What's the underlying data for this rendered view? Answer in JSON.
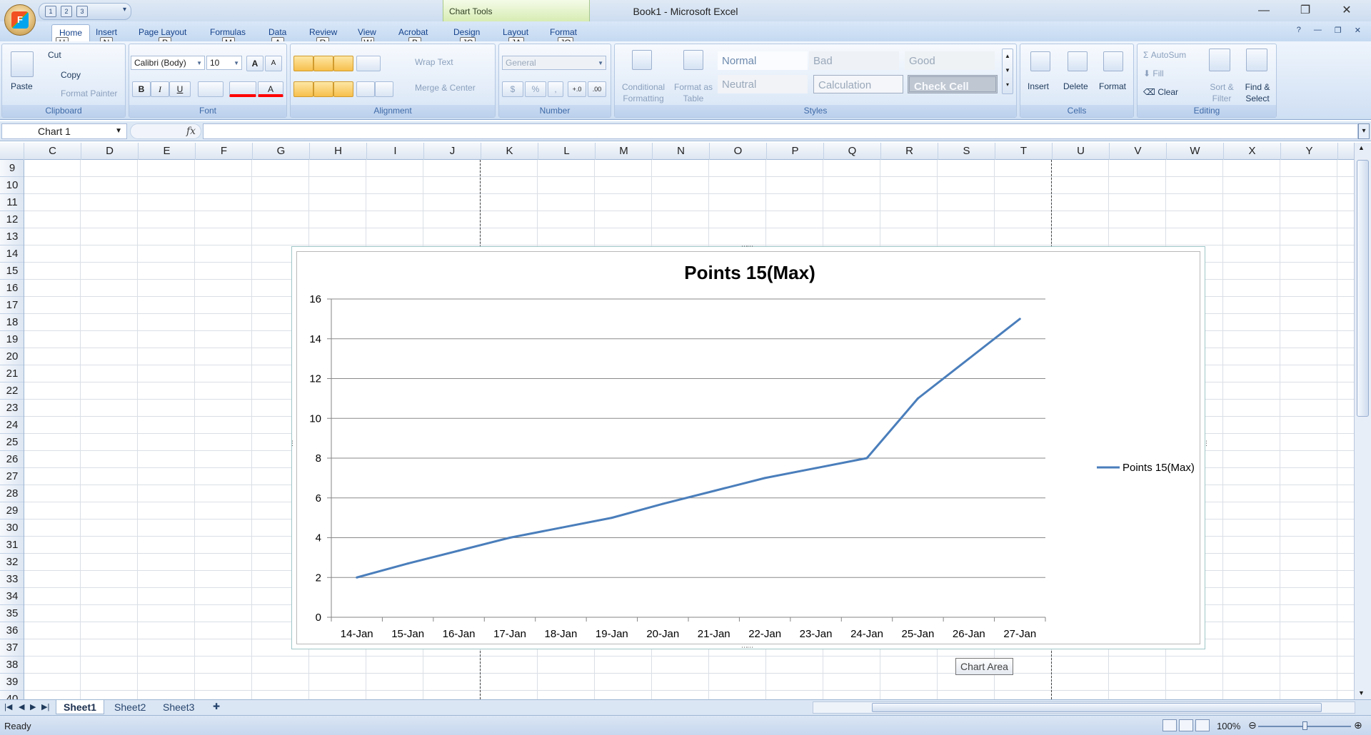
{
  "window": {
    "title": "Book1 - Microsoft Excel",
    "context_tab": "Chart Tools",
    "minimize": "—",
    "restore": "❐",
    "close": "✕"
  },
  "qat": {
    "keytips": [
      "1",
      "2",
      "3"
    ],
    "more": "▾"
  },
  "ribbon_tabs": [
    {
      "label": "Home",
      "keytip": "H"
    },
    {
      "label": "Insert",
      "keytip": "N"
    },
    {
      "label": "Page Layout",
      "keytip": "P"
    },
    {
      "label": "Formulas",
      "keytip": "M"
    },
    {
      "label": "Data",
      "keytip": "A"
    },
    {
      "label": "Review",
      "keytip": "R"
    },
    {
      "label": "View",
      "keytip": "W"
    },
    {
      "label": "Acrobat",
      "keytip": "B"
    },
    {
      "label": "Design",
      "keytip": "JC"
    },
    {
      "label": "Layout",
      "keytip": "JA"
    },
    {
      "label": "Format",
      "keytip": "JO"
    }
  ],
  "ribbon_right": {
    "help": "?",
    "minimize": "—",
    "restore": "❐",
    "close": "✕"
  },
  "clipboard": {
    "label": "Clipboard",
    "paste": "Paste",
    "cut": "Cut",
    "copy": "Copy",
    "format_painter": "Format Painter"
  },
  "font": {
    "label": "Font",
    "name": "Calibri (Body)",
    "size": "10",
    "grow": "A",
    "shrink": "A",
    "bold": "B",
    "italic": "I",
    "underline": "U",
    "font_color": "A"
  },
  "alignment": {
    "label": "Alignment",
    "wrap_text": "Wrap Text",
    "merge_center": "Merge & Center"
  },
  "number": {
    "label": "Number",
    "format": "General",
    "currency": "$",
    "percent": "%",
    "comma": ",",
    "inc_decimal": "+.0",
    "dec_decimal": ".00"
  },
  "styles": {
    "label": "Styles",
    "conditional_formatting": [
      "Conditional",
      "Formatting"
    ],
    "format_as_table": [
      "Format as",
      "Table"
    ],
    "cells": [
      "Normal",
      "Bad",
      "Good",
      "Neutral",
      "Calculation",
      "Check Cell"
    ],
    "colors": {
      "normal_bg": "#ffffff",
      "bad_bg": "#ffc7ce",
      "good_bg": "#c6efce",
      "neutral_bg": "#ffeb9c",
      "calc_bg": "#f2f2f2",
      "check_bg": "#a5a5a5"
    }
  },
  "cells_group": {
    "label": "Cells",
    "insert": "Insert",
    "delete": "Delete",
    "format": "Format"
  },
  "editing": {
    "label": "Editing",
    "autosum": "AutoSum",
    "fill": "Fill",
    "clear": "Clear",
    "sort_filter": [
      "Sort &",
      "Filter"
    ],
    "find_select": [
      "Find &",
      "Select"
    ]
  },
  "formula_bar": {
    "name_box": "Chart 1",
    "fx": "fx",
    "value": ""
  },
  "columns": [
    "C",
    "D",
    "E",
    "F",
    "G",
    "H",
    "I",
    "J",
    "K",
    "L",
    "M",
    "N",
    "O",
    "P",
    "Q",
    "R",
    "S",
    "T",
    "U",
    "V",
    "W",
    "X",
    "Y"
  ],
  "rows": [
    "9",
    "10",
    "11",
    "12",
    "13",
    "14",
    "15",
    "16",
    "17",
    "18",
    "19",
    "20",
    "21",
    "22",
    "23",
    "24",
    "25",
    "26",
    "27",
    "28",
    "29",
    "30",
    "31",
    "32",
    "33",
    "34",
    "35",
    "36",
    "37",
    "38",
    "39",
    "40"
  ],
  "chart_data": {
    "type": "line",
    "title": "Points 15(Max)",
    "categories": [
      "14-Jan",
      "15-Jan",
      "16-Jan",
      "17-Jan",
      "18-Jan",
      "19-Jan",
      "20-Jan",
      "21-Jan",
      "22-Jan",
      "23-Jan",
      "24-Jan",
      "25-Jan",
      "26-Jan",
      "27-Jan"
    ],
    "series": [
      {
        "name": "Points 15(Max)",
        "values": [
          2,
          2.7,
          3.35,
          4,
          4.5,
          5,
          5.7,
          6.35,
          7,
          7.5,
          8,
          11,
          13,
          15
        ],
        "color": "#4a7ebb"
      }
    ],
    "ylim": [
      0,
      16
    ],
    "yticks": [
      0,
      2,
      4,
      6,
      8,
      10,
      12,
      14,
      16
    ],
    "grid": true,
    "legend": "right",
    "xlabel": "",
    "ylabel": ""
  },
  "tooltip": "Chart Area",
  "sheets": [
    "Sheet1",
    "Sheet2",
    "Sheet3"
  ],
  "status": {
    "text": "Ready",
    "zoom": "100%"
  }
}
